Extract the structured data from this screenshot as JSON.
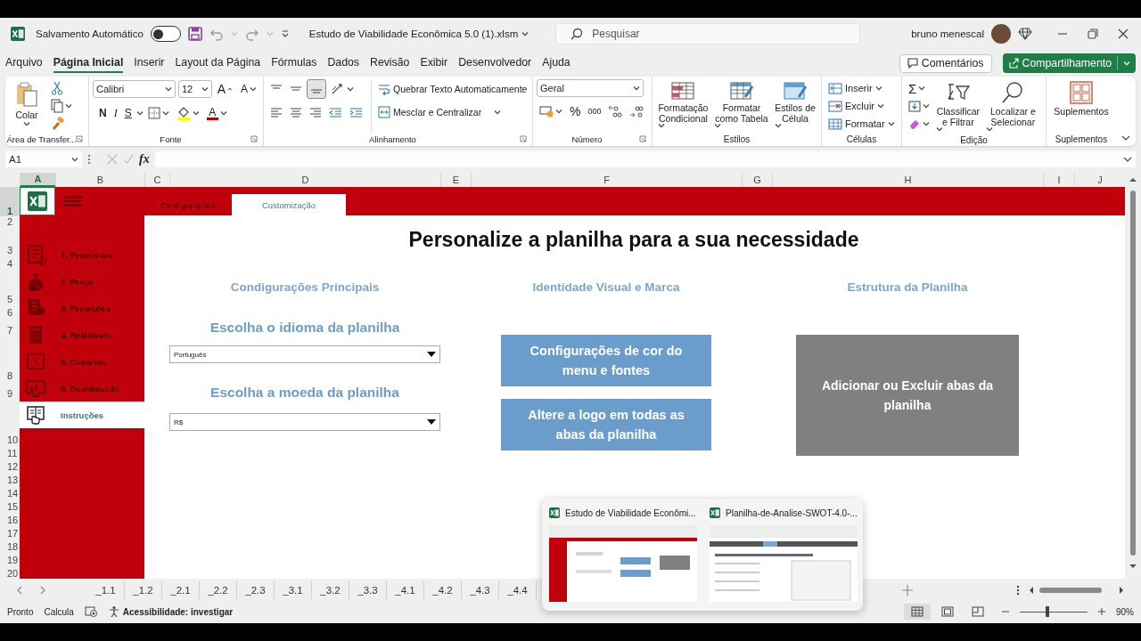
{
  "title_bar": {
    "autosave_label": "Salvamento Automático",
    "autosave_on": false,
    "file_name": "Estudo de Viabilidade Econômica 5.0 (1).xlsm",
    "search": {
      "placeholder": "Pesquisar"
    },
    "user_name": "bruno menescal"
  },
  "menu_tabs": [
    {
      "label": "Arquivo",
      "selected": false
    },
    {
      "label": "Página Inicial",
      "selected": true
    },
    {
      "label": "Inserir",
      "selected": false
    },
    {
      "label": "Layout da Página",
      "selected": false
    },
    {
      "label": "Fórmulas",
      "selected": false
    },
    {
      "label": "Dados",
      "selected": false
    },
    {
      "label": "Revisão",
      "selected": false
    },
    {
      "label": "Exibir",
      "selected": false
    },
    {
      "label": "Desenvolvedor",
      "selected": false
    },
    {
      "label": "Ajuda",
      "selected": false
    }
  ],
  "comments_button": "Comentários",
  "share_button": "Compartilhamento",
  "ribbon": {
    "clipboard": {
      "label": "Área de Transfer...",
      "paste": "Colar"
    },
    "font": {
      "label": "Fonte",
      "family": "Calibri",
      "size": "12",
      "grow": "A",
      "shrink": "A",
      "bold": "N",
      "italic": "I",
      "underline": "S",
      "font_color_glyph": "A"
    },
    "alignment": {
      "label": "Alinhamento",
      "vertical": [
        {
          "selected": false
        },
        {
          "selected": false
        },
        {
          "selected": true
        }
      ],
      "wrap_text": "Quebrar Texto Automaticamente",
      "merge": "Mesclar e Centralizar"
    },
    "number": {
      "label": "Número",
      "format": "Geral",
      "percent": "%",
      "thousands": "000"
    },
    "styles": {
      "label": "Estilos",
      "buttons": [
        "Formatação Condicional",
        "Formatar como Tabela",
        "Estilos de Célula"
      ]
    },
    "cells": {
      "label": "Células",
      "buttons": [
        "Inserir",
        "Excluir",
        "Formatar"
      ]
    },
    "editing": {
      "label": "Edição",
      "sum": "Σ",
      "buttons": [
        "Classificar e Filtrar",
        "Localizar e Selecionar"
      ]
    },
    "addins": {
      "label": "Suplementos",
      "button": "Suplementos"
    }
  },
  "formula_bar": {
    "name_box": "A1",
    "fx": "fx"
  },
  "grid": {
    "columns": [
      {
        "label": "A",
        "selected": true
      },
      {
        "label": "B",
        "selected": false
      },
      {
        "label": "C",
        "selected": false
      },
      {
        "label": "D",
        "selected": false
      },
      {
        "label": "E",
        "selected": false
      },
      {
        "label": "F",
        "selected": false
      },
      {
        "label": "G",
        "selected": false
      },
      {
        "label": "H",
        "selected": false
      },
      {
        "label": "I",
        "selected": false
      },
      {
        "label": "J",
        "selected": false
      }
    ],
    "rows": [
      {
        "label": "1",
        "selected": true
      },
      {
        "label": "2",
        "selected": false
      },
      {
        "label": "3",
        "selected": false
      },
      {
        "label": "4",
        "selected": false
      },
      {
        "label": "5",
        "selected": false
      },
      {
        "label": "6",
        "selected": false
      },
      {
        "label": "7",
        "selected": false
      },
      {
        "label": "8",
        "selected": false
      },
      {
        "label": "9",
        "selected": false
      },
      {
        "label": "10",
        "selected": false
      },
      {
        "label": "11",
        "selected": false
      },
      {
        "label": "12",
        "selected": false
      },
      {
        "label": "13",
        "selected": false
      },
      {
        "label": "14",
        "selected": false
      },
      {
        "label": "15",
        "selected": false
      },
      {
        "label": "16",
        "selected": false
      },
      {
        "label": "17",
        "selected": false
      },
      {
        "label": "18",
        "selected": false
      },
      {
        "label": "19",
        "selected": false
      },
      {
        "label": "20",
        "selected": false
      }
    ]
  },
  "sheet": {
    "top_tabs": [
      {
        "label": "Configurações",
        "selected": false
      },
      {
        "label": "Customização",
        "selected": true
      }
    ],
    "nav": [
      {
        "label": "1. Premissas",
        "selected": false
      },
      {
        "label": "2. Preço",
        "selected": false
      },
      {
        "label": "3. Projeções",
        "selected": false
      },
      {
        "label": "4. Relatórios",
        "selected": false
      },
      {
        "label": "5. Cenários",
        "selected": false
      },
      {
        "label": "6. Dashboards",
        "selected": false
      },
      {
        "label": "Instruções",
        "selected": true
      }
    ],
    "title": "Personalize a planilha para a sua necessidade",
    "sections": [
      {
        "kind": "dropdowns",
        "heading": "Condigurações Principais",
        "fields": [
          {
            "label": "Escolha o idioma da planilha",
            "value": "Português"
          },
          {
            "label": "Escolha a moeda da planilha",
            "value": "R$"
          }
        ]
      },
      {
        "kind": "buttons",
        "heading": "Identidade Visual e Marca",
        "buttons": [
          "Configurações de cor do menu e fontes",
          "Altere a logo em todas as abas da planilha"
        ]
      },
      {
        "kind": "panel",
        "heading": "Estrutura da Planilha",
        "buttons": [
          "Adicionar ou Excluir abas da planilha"
        ]
      }
    ]
  },
  "sheet_tabs": [
    {
      "label": "_1.1",
      "selected": false
    },
    {
      "label": "_1.2",
      "selected": false
    },
    {
      "label": "_2.1",
      "selected": false
    },
    {
      "label": "_2.2",
      "selected": false
    },
    {
      "label": "_2.3",
      "selected": false
    },
    {
      "label": "_3.1",
      "selected": false
    },
    {
      "label": "_3.2",
      "selected": false
    },
    {
      "label": "_3.3",
      "selected": false
    },
    {
      "label": "_4.1",
      "selected": false
    },
    {
      "label": "_4.2",
      "selected": false
    },
    {
      "label": "_4.3",
      "selected": false
    },
    {
      "label": "_4.4",
      "selected": false
    }
  ],
  "status_bar": {
    "ready": "Pronto",
    "calc": "Calcula",
    "accessibility": "Acessibilidade: investigar",
    "views": [
      {
        "selected": true
      },
      {
        "selected": false
      },
      {
        "selected": false
      }
    ],
    "zoom": {
      "level": 0.41,
      "reading": "90%"
    }
  },
  "taskbar_preview": {
    "windows": [
      {
        "title": "Estudo de Viabilidade Econômi..."
      },
      {
        "title": "Planilha-de-Analise-SWOT-4.0-..."
      }
    ]
  }
}
